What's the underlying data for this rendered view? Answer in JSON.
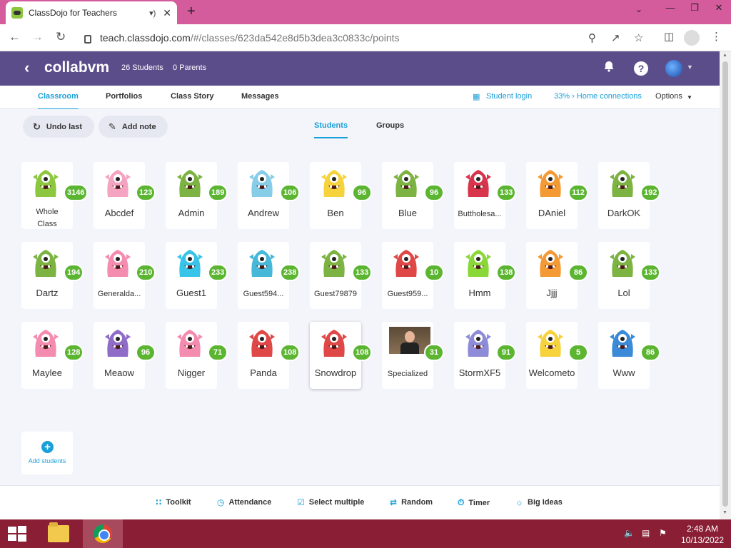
{
  "browser": {
    "tab_title": "ClassDojo for Teachers",
    "url_host": "teach.classdojo.com",
    "url_path": "/#/classes/623da542e8d5b3dea3c0833c/points"
  },
  "header": {
    "class_name": "collabvm",
    "students_count": "26 Students",
    "parents_count": "0 Parents"
  },
  "subnav": {
    "tabs": [
      {
        "label": "Classroom",
        "active": true
      },
      {
        "label": "Portfolios"
      },
      {
        "label": "Class Story"
      },
      {
        "label": "Messages"
      }
    ],
    "student_login": "Student login",
    "home_connections": "33% › Home connections",
    "options": "Options"
  },
  "actions": {
    "undo_last": "Undo last",
    "add_note": "Add note",
    "tab_students": "Students",
    "tab_groups": "Groups"
  },
  "students": [
    {
      "name": "Whole Class",
      "points": "3146",
      "color": "#8dc63f"
    },
    {
      "name": "Abcdef",
      "points": "123",
      "color": "#f4a4c0"
    },
    {
      "name": "Admin",
      "points": "189",
      "color": "#7cb342"
    },
    {
      "name": "Andrew",
      "points": "106",
      "color": "#88cde8"
    },
    {
      "name": "Ben",
      "points": "96",
      "color": "#f6d23c"
    },
    {
      "name": "Blue",
      "points": "96",
      "color": "#7cb342"
    },
    {
      "name": "Buttholesa...",
      "points": "133",
      "color": "#d8344c"
    },
    {
      "name": "DAniel",
      "points": "112",
      "color": "#f49a34"
    },
    {
      "name": "DarkOK",
      "points": "192",
      "color": "#7cb342"
    },
    {
      "name": "Dartz",
      "points": "194",
      "color": "#7cb342"
    },
    {
      "name": "Generalda...",
      "points": "210",
      "color": "#f48cb0"
    },
    {
      "name": "Guest1",
      "points": "233",
      "color": "#38c4e8"
    },
    {
      "name": "Guest594...",
      "points": "238",
      "color": "#48b8d8"
    },
    {
      "name": "Guest79879",
      "points": "133",
      "color": "#7cb342"
    },
    {
      "name": "Guest959...",
      "points": "10",
      "color": "#e04848"
    },
    {
      "name": "Hmm",
      "points": "138",
      "color": "#8ad838"
    },
    {
      "name": "Jjjj",
      "points": "86",
      "color": "#f49a34"
    },
    {
      "name": "Lol",
      "points": "133",
      "color": "#7cb342"
    },
    {
      "name": "Maylee",
      "points": "128",
      "color": "#f48cb0"
    },
    {
      "name": "Meaow",
      "points": "96",
      "color": "#8e6cc8"
    },
    {
      "name": "Nigger",
      "points": "71",
      "color": "#f48cb0"
    },
    {
      "name": "Panda",
      "points": "108",
      "color": "#e04848"
    },
    {
      "name": "Snowdrop",
      "points": "108",
      "color": "#e04848"
    },
    {
      "name": "Specialized",
      "points": "31",
      "color": "photo"
    },
    {
      "name": "StormXF5",
      "points": "91",
      "color": "#8e8cd8"
    },
    {
      "name": "Welcometo",
      "points": "5",
      "color": "#f6d23c"
    },
    {
      "name": "Www",
      "points": "86",
      "color": "#3a8ad8"
    }
  ],
  "add_students": "Add students",
  "footer": {
    "toolkit": "Toolkit",
    "attendance": "Attendance",
    "select_multiple": "Select multiple",
    "random": "Random",
    "timer": "Timer",
    "big_ideas": "Big Ideas"
  },
  "taskbar": {
    "time": "2:48 AM",
    "date": "10/13/2022"
  }
}
